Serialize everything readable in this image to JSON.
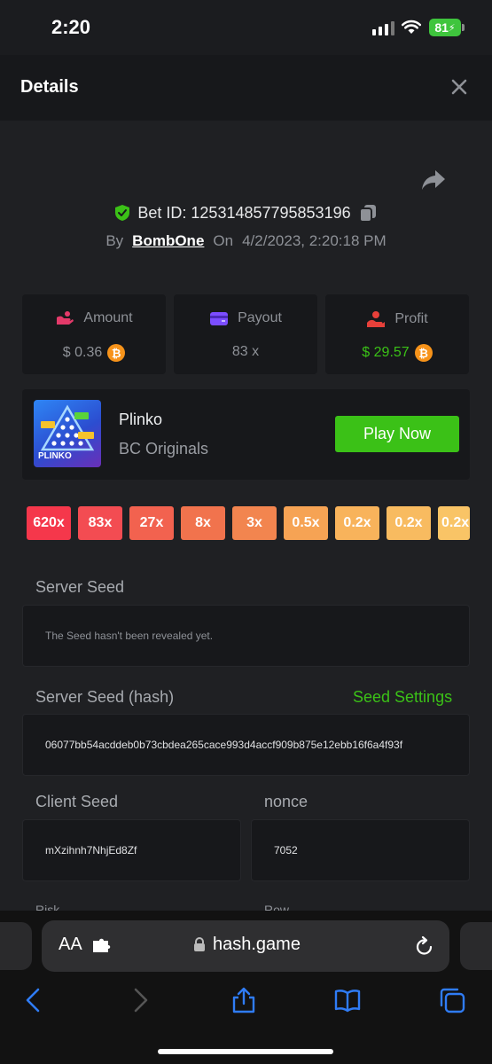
{
  "status_bar": {
    "time": "2:20",
    "battery": "81"
  },
  "header": {
    "title": "Details"
  },
  "bet": {
    "id_label": "Bet ID: 125314857795853196",
    "by": "By",
    "user": "BombOne",
    "on": "On",
    "date": "4/2/2023, 2:20:18 PM"
  },
  "stats": {
    "amount_label": "Amount",
    "amount_value": "$ 0.36",
    "payout_label": "Payout",
    "payout_value": "83 x",
    "profit_label": "Profit",
    "profit_value": "$ 29.57"
  },
  "game": {
    "name": "Plinko",
    "provider": "BC Originals",
    "play_label": "Play Now",
    "thumb_text": "PLINKO"
  },
  "multipliers": [
    "620x",
    "83x",
    "27x",
    "8x",
    "3x",
    "0.5x",
    "0.2x",
    "0.2x",
    "0.2x"
  ],
  "multiplier_colors": [
    "#f5374b",
    "#f34c52",
    "#f2624f",
    "#f1734d",
    "#f2854f",
    "#f6a354",
    "#f8b35b",
    "#f8bb60",
    "#f9c466"
  ],
  "fields": {
    "server_seed_label": "Server Seed",
    "server_seed_value": "The Seed hasn't been revealed yet.",
    "server_hash_label": "Server Seed (hash)",
    "seed_settings": "Seed Settings",
    "server_hash_value": "06077bb54acddeb0b73cbdea265cace993d4accf909b875e12ebb16f6a4f93f",
    "client_seed_label": "Client Seed",
    "client_seed_value": "mXzihnh7NhjEd8Zf",
    "nonce_label": "nonce",
    "nonce_value": "7052",
    "risk_label": "Risk",
    "row_label": "Row"
  },
  "browser": {
    "aa": "AA",
    "url": "hash.game"
  },
  "colors": {
    "accent_green": "#3bc117",
    "btc_orange": "#f7931a",
    "background": "#1f2023"
  }
}
